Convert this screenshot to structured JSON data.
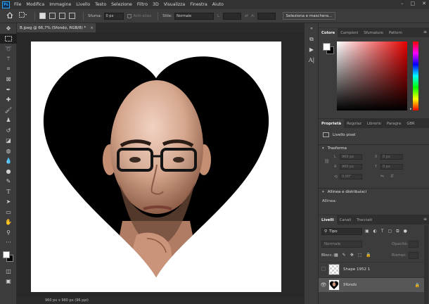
{
  "menu": {
    "logo": "Ps",
    "items": [
      "File",
      "Modifica",
      "Immagine",
      "Livello",
      "Testo",
      "Selezione",
      "Filtro",
      "3D",
      "Visualizza",
      "Finestra",
      "Aiuto"
    ],
    "window_buttons": [
      "–",
      "□",
      "✕"
    ]
  },
  "options": {
    "sfuma_label": "Sfuma:",
    "sfuma_value": "0 px",
    "antialias_label": "Anti-alias",
    "stile_label": "Stile:",
    "stile_value": "Normale",
    "l_label": "L:",
    "a_label": "A:",
    "select_mask_button": "Seleziona e maschera..."
  },
  "document": {
    "tab_title": "B.jpeg @ 66,7% (Sfondo, RGB/8) *",
    "status": "960 px x 960 px (96 ppi)"
  },
  "panels": {
    "color_tabs": [
      "Colore",
      "Campioni",
      "Sfumature",
      "Pattern"
    ],
    "props_tabs": [
      "Proprietà",
      "Regolaz",
      "Librerie",
      "Paragra",
      "GBR"
    ],
    "pixel_layer_label": "Livello pixel",
    "transform_title": "Trasforma",
    "fields": {
      "l": "L",
      "a": "A",
      "x": "X",
      "y": "Y",
      "l_val": "960 px",
      "a_val": "960 px",
      "x_val": "0 px",
      "y_val": "0 px",
      "angle_val": "0,00°"
    },
    "align_title": "Allinea e distribuisci",
    "align_label": "Allinea:",
    "layers_tabs": [
      "Livelli",
      "Canali",
      "Tracciati"
    ],
    "filter_value": "Tipo",
    "blend_mode": "Normale",
    "opacity_label": "Opacità:",
    "lock_label": "Blocc.:",
    "fill_label": "Riempi:",
    "layers": [
      {
        "name": "Shape 1952 1",
        "italic": false
      },
      {
        "name": "Sfondo",
        "italic": true
      }
    ]
  },
  "colors": {
    "accent": "#31a8ff",
    "fg_swatch": "#ffffff",
    "bg_swatch": "#000000"
  }
}
